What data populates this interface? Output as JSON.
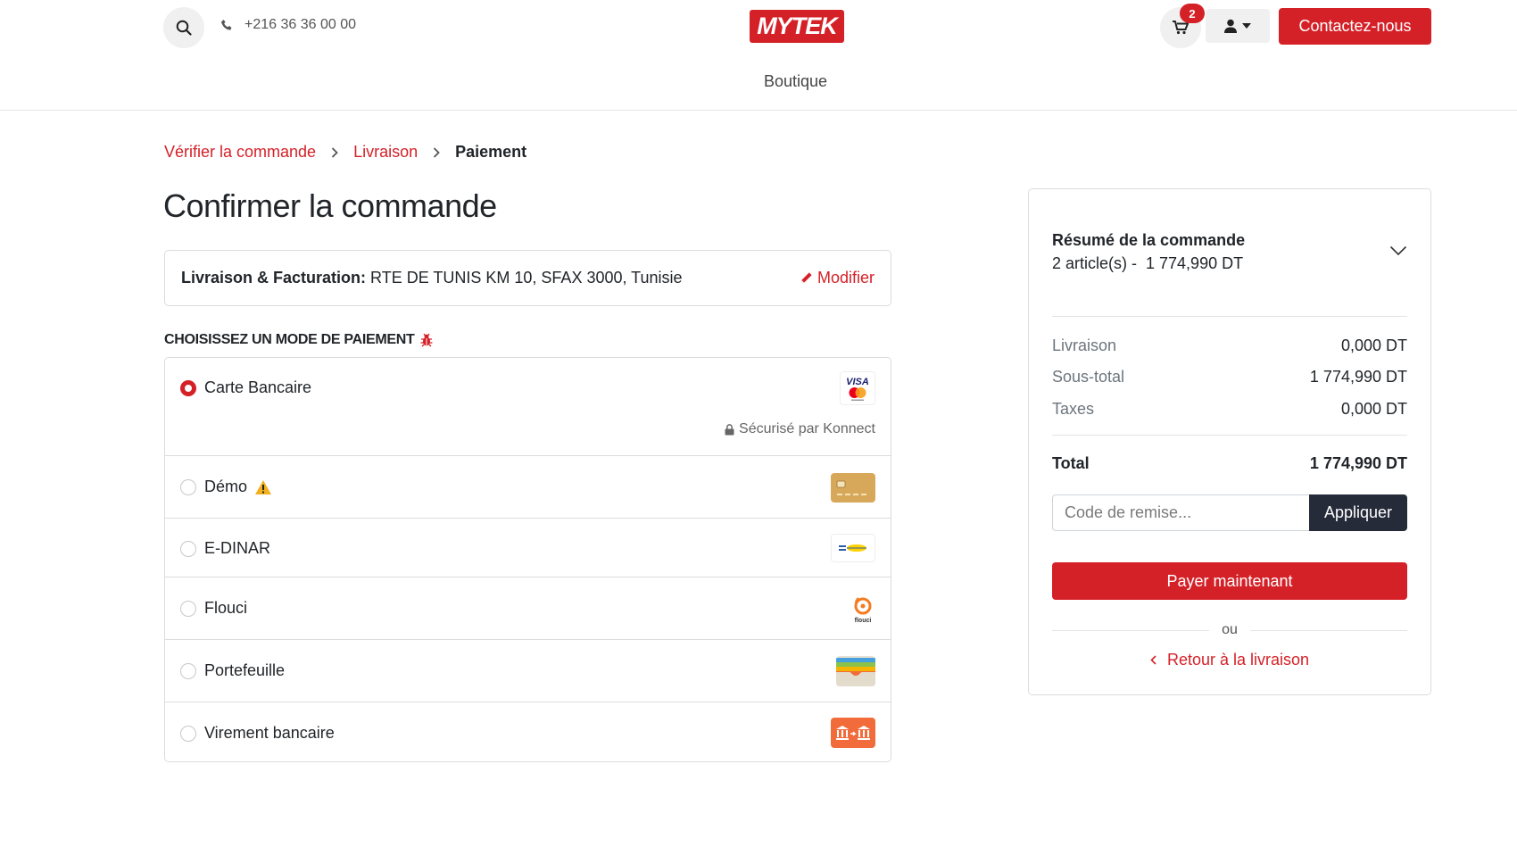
{
  "header": {
    "phone": "+216 36 36 00 00",
    "logo_text": "MYTEK",
    "nav_item": "Boutique",
    "cart_count": "2",
    "contact_label": "Contactez-nous",
    "brand_color": "#d42128"
  },
  "breadcrumb": {
    "step1": "Vérifier la commande",
    "step2": "Livraison",
    "step3": "Paiement"
  },
  "page_title": "Confirmer la commande",
  "address": {
    "label": "Livraison & Facturation:",
    "value": "RTE DE TUNIS KM 10, SFAX 3000, Tunisie",
    "modify_label": "Modifier"
  },
  "payment": {
    "heading": "CHOISISSEZ UN MODE DE PAIEMENT",
    "selected": "Carte Bancaire",
    "secure_text": "Sécurisé par Konnect",
    "methods": [
      {
        "label": "Carte Bancaire",
        "icon": "visa-mastercard-icon",
        "checked": true
      },
      {
        "label": "Démo",
        "icon": "credit-card-icon",
        "checked": false
      },
      {
        "label": "E-DINAR",
        "icon": "edinar-icon",
        "checked": false
      },
      {
        "label": "Flouci",
        "icon": "flouci-icon",
        "checked": false
      },
      {
        "label": "Portefeuille",
        "icon": "wallet-icon",
        "checked": false
      },
      {
        "label": "Virement bancaire",
        "icon": "bank-transfer-icon",
        "checked": false
      }
    ]
  },
  "summary": {
    "title": "Résumé de la commande",
    "items_text": "2 article(s) -  1 774,990 DT",
    "rows": [
      {
        "label": "Livraison",
        "value": "0,000 DT"
      },
      {
        "label": "Sous-total",
        "value": "1 774,990 DT"
      },
      {
        "label": "Taxes",
        "value": "0,000 DT"
      }
    ],
    "total_label": "Total",
    "total_value": "1 774,990 DT",
    "coupon_placeholder": "Code de remise...",
    "apply_label": "Appliquer",
    "pay_label": "Payer maintenant",
    "or_text": "ou",
    "back_label": "Retour à la livraison"
  }
}
